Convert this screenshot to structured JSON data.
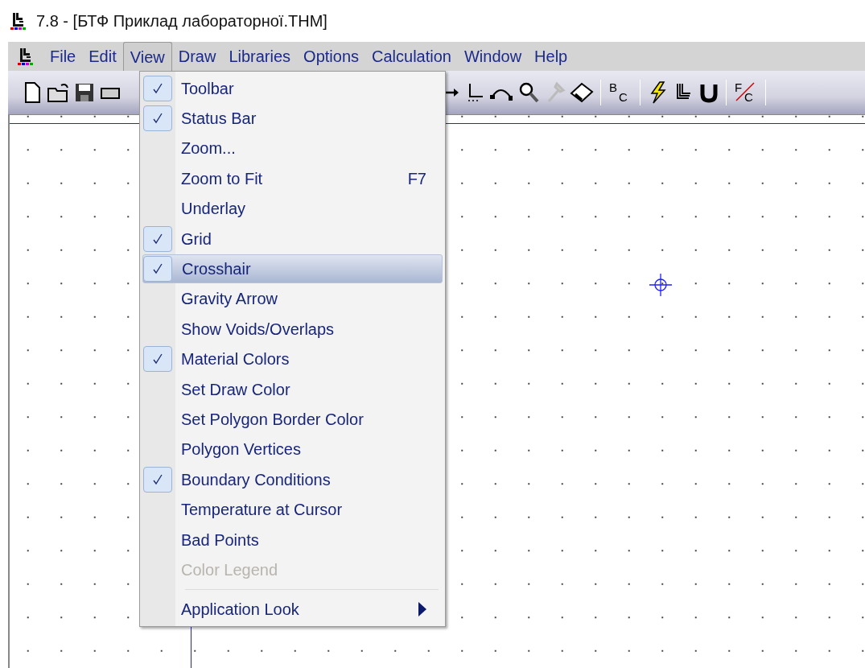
{
  "window": {
    "title": "7.8 - [БТФ Приклад лабораторної.THM]"
  },
  "menu_bar": [
    {
      "label": "File",
      "selected": false
    },
    {
      "label": "Edit",
      "selected": false
    },
    {
      "label": "View",
      "selected": true
    },
    {
      "label": "Draw",
      "selected": false
    },
    {
      "label": "Libraries",
      "selected": false
    },
    {
      "label": "Options",
      "selected": false
    },
    {
      "label": "Calculation",
      "selected": false
    },
    {
      "label": "Window",
      "selected": false
    },
    {
      "label": "Help",
      "selected": false
    }
  ],
  "toolbar_units": [
    {
      "top": "B",
      "bottom": "C",
      "crossed": false
    },
    {
      "top": "F",
      "bottom": "C",
      "crossed": true
    }
  ],
  "view_menu": [
    {
      "kind": "item",
      "label": "Toolbar",
      "checked": true,
      "selected": false,
      "disabled": false
    },
    {
      "kind": "item",
      "label": "Status Bar",
      "checked": true,
      "selected": false,
      "disabled": false
    },
    {
      "kind": "item",
      "label": "Zoom...",
      "checked": false,
      "selected": false,
      "disabled": false
    },
    {
      "kind": "item",
      "label": "Zoom to Fit",
      "shortcut": "F7",
      "checked": false,
      "selected": false,
      "disabled": false
    },
    {
      "kind": "item",
      "label": "Underlay",
      "checked": false,
      "selected": false,
      "disabled": false
    },
    {
      "kind": "item",
      "label": "Grid",
      "checked": true,
      "selected": false,
      "disabled": false
    },
    {
      "kind": "item",
      "label": "Crosshair",
      "checked": true,
      "selected": true,
      "disabled": false
    },
    {
      "kind": "item",
      "label": "Gravity Arrow",
      "checked": false,
      "selected": false,
      "disabled": false
    },
    {
      "kind": "item",
      "label": "Show Voids/Overlaps",
      "checked": false,
      "selected": false,
      "disabled": false
    },
    {
      "kind": "item",
      "label": "Material Colors",
      "checked": true,
      "selected": false,
      "disabled": false
    },
    {
      "kind": "item",
      "label": "Set Draw Color",
      "checked": false,
      "selected": false,
      "disabled": false
    },
    {
      "kind": "item",
      "label": "Set Polygon Border Color",
      "checked": false,
      "selected": false,
      "disabled": false
    },
    {
      "kind": "item",
      "label": "Polygon Vertices",
      "checked": false,
      "selected": false,
      "disabled": false
    },
    {
      "kind": "item",
      "label": "Boundary Conditions",
      "checked": true,
      "selected": false,
      "disabled": false
    },
    {
      "kind": "item",
      "label": "Temperature at Cursor",
      "checked": false,
      "selected": false,
      "disabled": false
    },
    {
      "kind": "item",
      "label": "Bad Points",
      "checked": false,
      "selected": false,
      "disabled": false
    },
    {
      "kind": "item",
      "label": "Color Legend",
      "checked": false,
      "selected": false,
      "disabled": true
    },
    {
      "kind": "separator"
    },
    {
      "kind": "submenu",
      "label": "Application Look",
      "checked": false,
      "selected": false,
      "disabled": false
    }
  ]
}
